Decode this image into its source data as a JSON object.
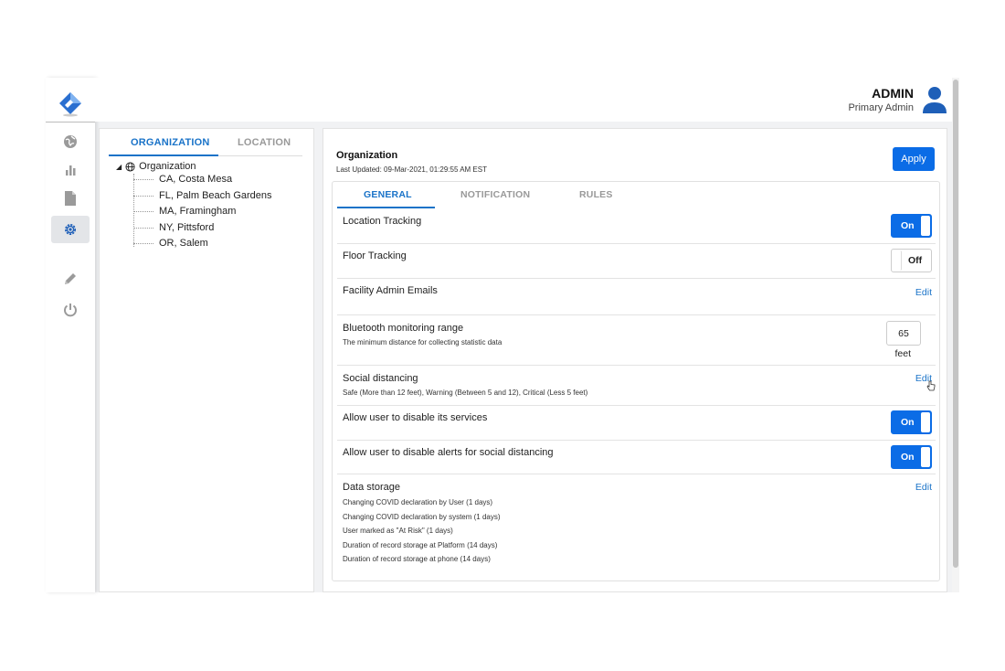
{
  "header": {
    "admin_name": "ADMIN",
    "admin_role": "Primary Admin"
  },
  "rail": {
    "items": [
      {
        "icon": "globe-icon"
      },
      {
        "icon": "bar-chart-icon"
      },
      {
        "icon": "document-icon"
      },
      {
        "icon": "gear-icon",
        "active": true
      },
      {
        "icon": "pencil-icon"
      },
      {
        "icon": "power-icon"
      }
    ]
  },
  "tree": {
    "tabs": [
      "ORGANIZATION",
      "LOCATION"
    ],
    "root": "Organization",
    "children": [
      "CA, Costa Mesa",
      "FL, Palm Beach Gardens",
      "MA, Framingham",
      "NY, Pittsford",
      "OR, Salem"
    ]
  },
  "main": {
    "title": "Organization",
    "last_updated": "Last Updated: 09-Mar-2021, 01:29:55 AM EST",
    "apply_label": "Apply",
    "tabs": [
      "GENERAL",
      "NOTIFICATION",
      "RULES"
    ],
    "settings": {
      "location_tracking": {
        "label": "Location Tracking",
        "state": "On"
      },
      "floor_tracking": {
        "label": "Floor Tracking",
        "state": "Off"
      },
      "facility_admin_emails": {
        "label": "Facility Admin Emails",
        "action": "Edit"
      },
      "bluetooth_range": {
        "label": "Bluetooth monitoring range",
        "desc": "The minimum distance for collecting statistic data",
        "value": "65",
        "unit": "feet"
      },
      "social_distancing": {
        "label": "Social distancing",
        "desc": "Safe (More than 12 feet), Warning (Between 5 and 12), Critical (Less 5 feet)",
        "action": "Edit"
      },
      "disable_services": {
        "label": "Allow user to disable its services",
        "state": "On"
      },
      "disable_alerts": {
        "label": "Allow user to disable alerts for social distancing",
        "state": "On"
      },
      "data_storage": {
        "label": "Data storage",
        "action": "Edit",
        "lines": [
          "Changing COVID declaration by User (1 days)",
          "Changing COVID declaration by system (1 days)",
          "User marked as \"At Risk\" (1 days)",
          "Duration of record storage at Platform (14 days)",
          "Duration of record storage at phone (14 days)"
        ]
      }
    }
  },
  "colors": {
    "accent": "#0b6ce6",
    "link": "#1a73c8",
    "logo_blue": "#1e5fb8"
  }
}
